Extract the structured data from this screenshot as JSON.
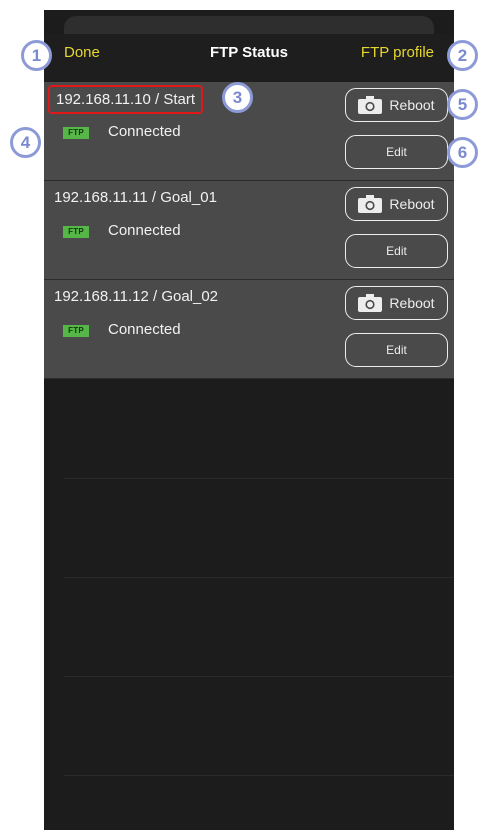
{
  "navbar": {
    "done_label": "Done",
    "title": "FTP Status",
    "profile_label": "FTP profile"
  },
  "rows": [
    {
      "title": "192.168.11.10 / Start",
      "badge": "FTP",
      "status": "Connected",
      "reboot_label": "Reboot",
      "edit_label": "Edit"
    },
    {
      "title": "192.168.11.11 / Goal_01",
      "badge": "FTP",
      "status": "Connected",
      "reboot_label": "Reboot",
      "edit_label": "Edit"
    },
    {
      "title": "192.168.11.12 / Goal_02",
      "badge": "FTP",
      "status": "Connected",
      "reboot_label": "Reboot",
      "edit_label": "Edit"
    }
  ],
  "callouts": [
    "1",
    "2",
    "3",
    "4",
    "5",
    "6"
  ],
  "colors": {
    "accent_yellow": "#e6d72e",
    "row_bg": "#4a4a4a",
    "badge_green": "#56b648",
    "highlight_red": "#e01818",
    "callout_blue": "#8d9ad8"
  },
  "icons": {
    "reboot": "camera-icon"
  }
}
